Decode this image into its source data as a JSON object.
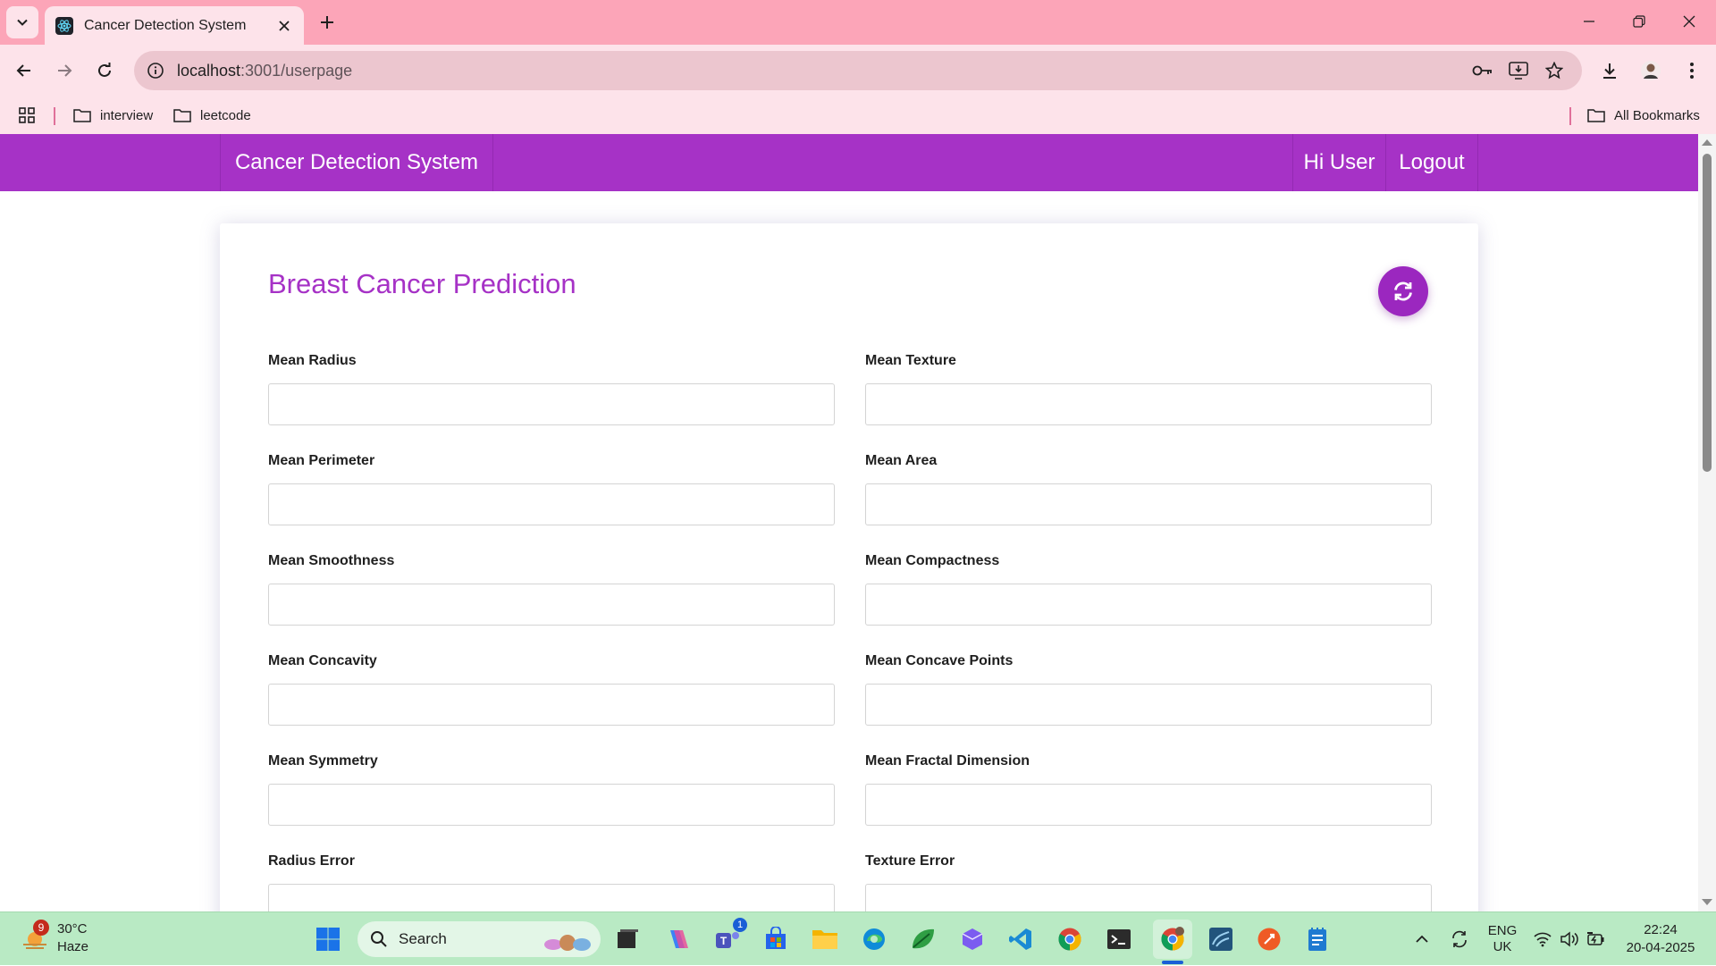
{
  "browser": {
    "tab_title": "Cancer Detection System",
    "url_host": "localhost",
    "url_rest": ":3001/userpage",
    "bookmarks": [
      {
        "label": "interview"
      },
      {
        "label": "leetcode"
      }
    ],
    "all_bookmarks": "All Bookmarks"
  },
  "navbar": {
    "brand": "Cancer Detection System",
    "greeting": "Hi User",
    "logout": "Logout"
  },
  "form": {
    "title": "Breast Cancer Prediction",
    "fields": [
      {
        "label": "Mean Radius",
        "value": ""
      },
      {
        "label": "Mean Texture",
        "value": ""
      },
      {
        "label": "Mean Perimeter",
        "value": ""
      },
      {
        "label": "Mean Area",
        "value": ""
      },
      {
        "label": "Mean Smoothness",
        "value": ""
      },
      {
        "label": "Mean Compactness",
        "value": ""
      },
      {
        "label": "Mean Concavity",
        "value": ""
      },
      {
        "label": "Mean Concave Points",
        "value": ""
      },
      {
        "label": "Mean Symmetry",
        "value": ""
      },
      {
        "label": "Mean Fractal Dimension",
        "value": ""
      },
      {
        "label": "Radius Error",
        "value": ""
      },
      {
        "label": "Texture Error",
        "value": ""
      }
    ]
  },
  "taskbar": {
    "weather_temp": "30°C",
    "weather_cond": "Haze",
    "weather_badge": "9",
    "search_label": "Search",
    "teams_badge": "1",
    "lang_1": "ENG",
    "lang_2": "UK",
    "time": "22:24",
    "date": "20-04-2025"
  },
  "colors": {
    "accent": "#a632c6",
    "tabbar": "#fca5b8",
    "taskbar": "#b9eac4"
  }
}
